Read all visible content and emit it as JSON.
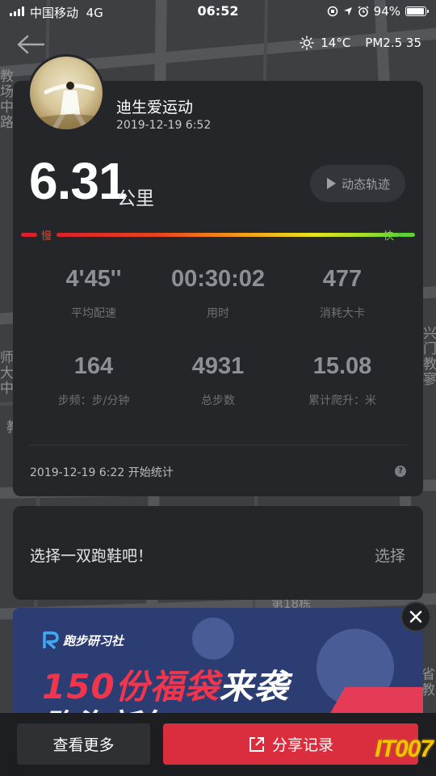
{
  "status_bar": {
    "carrier": "中国移动",
    "network": "4G",
    "time": "06:52",
    "battery_text": "94%",
    "battery_level": 0.94
  },
  "nav": {
    "back_icon": "arrow-left-icon",
    "weather": {
      "icon": "sun-icon",
      "temperature": "14°C",
      "pm25": "PM2.5 35"
    }
  },
  "map_labels": {
    "left_top": [
      "教",
      "场",
      "中",
      "路"
    ],
    "left_mid": [
      "师",
      "大",
      "中"
    ],
    "left_low": "教",
    "right_mid": [
      "兴",
      "门",
      "教",
      "寥"
    ],
    "building": "第18栋",
    "right_low": [
      "省",
      "教"
    ]
  },
  "activity": {
    "username": "迪生爱运动",
    "datetime": "2019-12-19 6:52",
    "distance": "6.31",
    "distance_unit": "公里",
    "track_button": "动态轨迹",
    "pace_slow": "慢",
    "pace_fast": "快",
    "stats": [
      {
        "value": "4'45''",
        "label": "平均配速"
      },
      {
        "value": "00:30:02",
        "label": "用时"
      },
      {
        "value": "477",
        "label": "消耗大卡"
      },
      {
        "value": "164",
        "label": "步频：步/分钟"
      },
      {
        "value": "4931",
        "label": "总步数"
      },
      {
        "value": "15.08",
        "label": "累计爬升：米"
      }
    ],
    "start_text": "2019-12-19 6:22 开始统计",
    "help": "?"
  },
  "shoes": {
    "prompt": "选择一双跑鞋吧！",
    "select": "选择"
  },
  "ad": {
    "logo": "跑步研习社",
    "headline_red": "150份福袋",
    "headline_white": "来袭",
    "subline": "跑海新年PB"
  },
  "bottom": {
    "more": "查看更多",
    "share": "分享记录"
  },
  "watermark": "IT007",
  "colors": {
    "card_bg": "#25262a",
    "share_red": "#da2e3e",
    "ad_blue": "#2c3d73",
    "pace_slow": "#d9222b",
    "pace_fast": "#5fcf37"
  }
}
